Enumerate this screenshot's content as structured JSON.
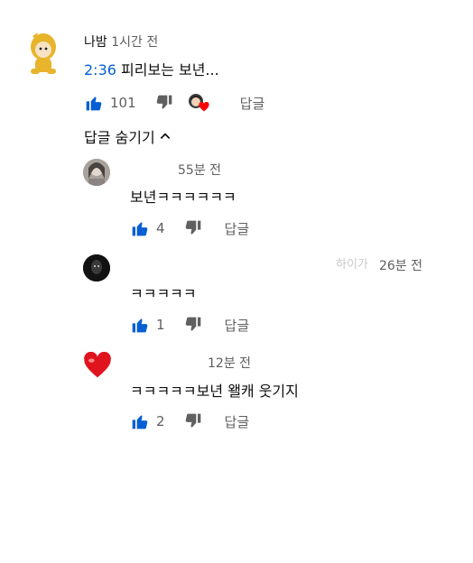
{
  "comment": {
    "author": "나밤",
    "time": "1시간 전",
    "timestamp": "2:36",
    "text": "피리보는 보년...",
    "likes": "101",
    "reply_label": "답글"
  },
  "hide_replies_label": "답글 숨기기",
  "replies": [
    {
      "time": "55분 전",
      "text": "보년ㅋㅋㅋㅋㅋㅋ",
      "likes": "4",
      "reply_label": "답글"
    },
    {
      "time": "26분 전",
      "faint_name": "하이가",
      "text": "ㅋㅋㅋㅋㅋ",
      "likes": "1",
      "reply_label": "답글"
    },
    {
      "time": "12분 전",
      "text": "ㅋㅋㅋㅋㅋ보년 왤캐 웃기지",
      "likes": "2",
      "reply_label": "답글"
    }
  ],
  "colors": {
    "link": "#065fd4",
    "like": "#065fd4",
    "muted": "#606060",
    "heart": "#ff0000"
  }
}
